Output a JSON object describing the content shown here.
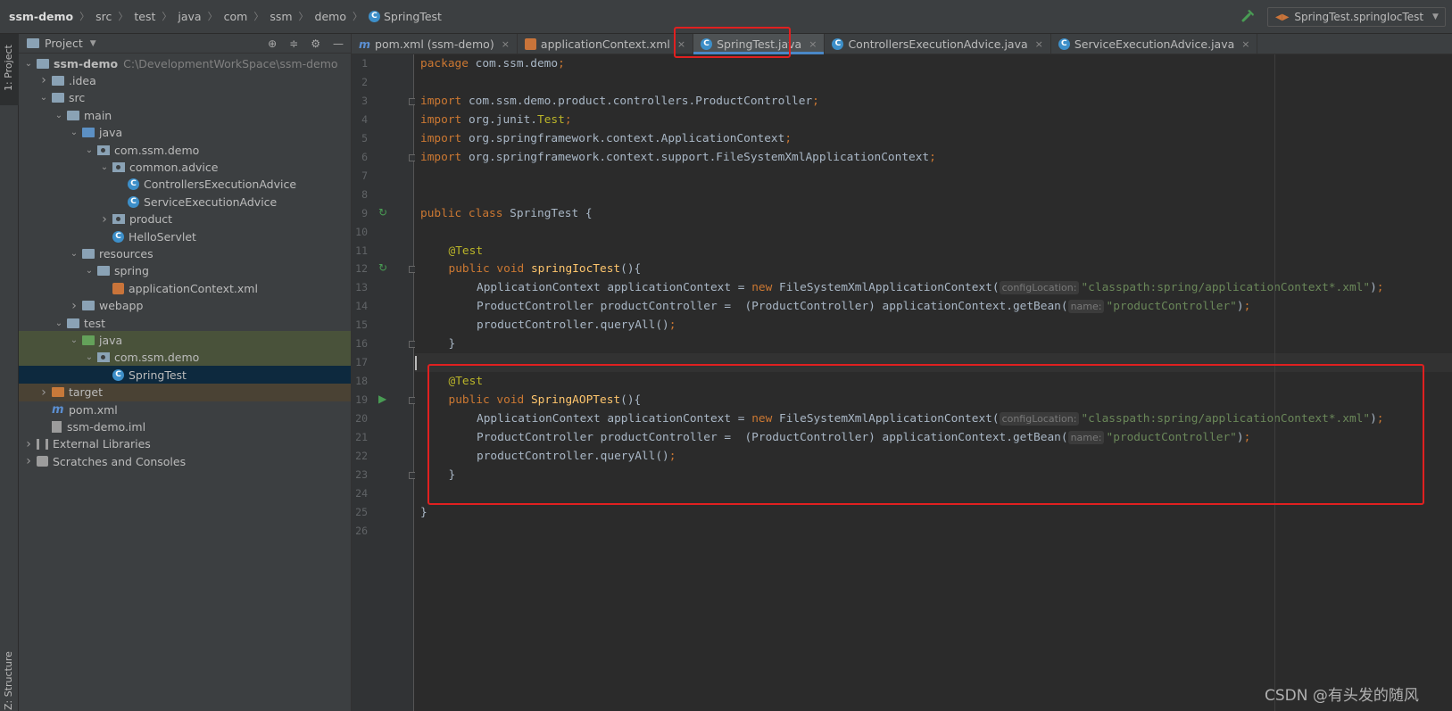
{
  "breadcrumb": {
    "items": [
      "ssm-demo",
      "src",
      "test",
      "java",
      "com",
      "ssm",
      "demo",
      "SpringTest"
    ]
  },
  "run_config": {
    "label": "SpringTest.springIocTest"
  },
  "left_stripe": {
    "project_label": "1: Project",
    "structure_label": "Z: Structure"
  },
  "project_panel": {
    "title": "Project",
    "tree": [
      {
        "label": "ssm-demo",
        "extra": "C:\\DevelopmentWorkSpace\\ssm-demo",
        "depth": 0,
        "arrow": "down",
        "icon": "module"
      },
      {
        "label": ".idea",
        "depth": 1,
        "arrow": "right",
        "icon": "folder"
      },
      {
        "label": "src",
        "depth": 1,
        "arrow": "down",
        "icon": "folder"
      },
      {
        "label": "main",
        "depth": 2,
        "arrow": "down",
        "icon": "folder"
      },
      {
        "label": "java",
        "depth": 3,
        "arrow": "down",
        "icon": "folder-src"
      },
      {
        "label": "com.ssm.demo",
        "depth": 4,
        "arrow": "down",
        "icon": "package"
      },
      {
        "label": "common.advice",
        "depth": 5,
        "arrow": "down",
        "icon": "package"
      },
      {
        "label": "ControllersExecutionAdvice",
        "depth": 6,
        "arrow": "none",
        "icon": "class"
      },
      {
        "label": "ServiceExecutionAdvice",
        "depth": 6,
        "arrow": "none",
        "icon": "class"
      },
      {
        "label": "product",
        "depth": 5,
        "arrow": "right",
        "icon": "package"
      },
      {
        "label": "HelloServlet",
        "depth": 5,
        "arrow": "none",
        "icon": "class"
      },
      {
        "label": "resources",
        "depth": 3,
        "arrow": "down",
        "icon": "folder-res"
      },
      {
        "label": "spring",
        "depth": 4,
        "arrow": "down",
        "icon": "folder"
      },
      {
        "label": "applicationContext.xml",
        "depth": 5,
        "arrow": "none",
        "icon": "xml"
      },
      {
        "label": "webapp",
        "depth": 3,
        "arrow": "right",
        "icon": "folder"
      },
      {
        "label": "test",
        "depth": 2,
        "arrow": "down",
        "icon": "folder"
      },
      {
        "label": "java",
        "depth": 3,
        "arrow": "down",
        "icon": "folder-test",
        "style": "hl-test"
      },
      {
        "label": "com.ssm.demo",
        "depth": 4,
        "arrow": "down",
        "icon": "package",
        "style": "hl-test"
      },
      {
        "label": "SpringTest",
        "depth": 5,
        "arrow": "none",
        "icon": "class",
        "style": "sel"
      },
      {
        "label": "target",
        "depth": 1,
        "arrow": "right",
        "icon": "folder-target",
        "style": "excl"
      },
      {
        "label": "pom.xml",
        "depth": 1,
        "arrow": "none",
        "icon": "maven"
      },
      {
        "label": "ssm-demo.iml",
        "depth": 1,
        "arrow": "none",
        "icon": "file"
      },
      {
        "label": "External Libraries",
        "depth": 0,
        "arrow": "right",
        "icon": "libs"
      },
      {
        "label": "Scratches and Consoles",
        "depth": 0,
        "arrow": "right",
        "icon": "scratch"
      }
    ]
  },
  "tabs": [
    {
      "label": "pom.xml (ssm-demo)",
      "icon": "maven",
      "close": "×"
    },
    {
      "label": "applicationContext.xml",
      "icon": "xml",
      "close": "×"
    },
    {
      "label": "SpringTest.java",
      "icon": "class",
      "close": "×",
      "active": true
    },
    {
      "label": "ControllersExecutionAdvice.java",
      "icon": "class",
      "close": "×"
    },
    {
      "label": "ServiceExecutionAdvice.java",
      "icon": "class",
      "close": "×"
    }
  ],
  "code_lines": [
    {
      "n": "1",
      "indent": 0,
      "parts": [
        {
          "c": "kw",
          "t": "package "
        },
        {
          "t": "com.ssm.demo"
        },
        {
          "c": "kw",
          "t": ";"
        }
      ]
    },
    {
      "n": "2",
      "indent": 0,
      "parts": []
    },
    {
      "n": "3",
      "indent": 0,
      "parts": [
        {
          "c": "kw",
          "t": "import "
        },
        {
          "t": "com.ssm.demo.product.controllers.ProductController"
        },
        {
          "c": "kw",
          "t": ";"
        }
      ]
    },
    {
      "n": "4",
      "indent": 0,
      "parts": [
        {
          "c": "kw",
          "t": "import "
        },
        {
          "t": "org.junit."
        },
        {
          "c": "an",
          "t": "Test"
        },
        {
          "c": "kw",
          "t": ";"
        }
      ]
    },
    {
      "n": "5",
      "indent": 0,
      "parts": [
        {
          "c": "kw",
          "t": "import "
        },
        {
          "t": "org.springframework.context.ApplicationContext"
        },
        {
          "c": "kw",
          "t": ";"
        }
      ]
    },
    {
      "n": "6",
      "indent": 0,
      "parts": [
        {
          "c": "kw",
          "t": "import "
        },
        {
          "t": "org.springframework.context.support.FileSystemXmlApplicationContext"
        },
        {
          "c": "kw",
          "t": ";"
        }
      ]
    },
    {
      "n": "7",
      "indent": 0,
      "parts": []
    },
    {
      "n": "8",
      "indent": 0,
      "parts": []
    },
    {
      "n": "9",
      "indent": 0,
      "parts": [
        {
          "c": "kw",
          "t": "public class "
        },
        {
          "t": "SpringTest {"
        }
      ]
    },
    {
      "n": "10",
      "indent": 0,
      "parts": []
    },
    {
      "n": "11",
      "indent": 1,
      "parts": [
        {
          "c": "an",
          "t": "@Test"
        }
      ]
    },
    {
      "n": "12",
      "indent": 1,
      "parts": [
        {
          "c": "kw",
          "t": "public void "
        },
        {
          "c": "fn",
          "t": "springIocTest"
        },
        {
          "t": "(){"
        }
      ]
    },
    {
      "n": "13",
      "indent": 2,
      "parts": [
        {
          "t": "ApplicationContext applicationContext = "
        },
        {
          "c": "kw",
          "t": "new "
        },
        {
          "t": "FileSystemXmlApplicationContext("
        },
        {
          "c": "hint",
          "t": "configLocation:"
        },
        {
          "c": "str",
          "t": "\"classpath:spring/applicationContext*.xml\""
        },
        {
          "t": ")"
        },
        {
          "c": "kw",
          "t": ";"
        }
      ]
    },
    {
      "n": "14",
      "indent": 2,
      "parts": [
        {
          "t": "ProductController productController =  (ProductController) applicationContext.getBean("
        },
        {
          "c": "hint",
          "t": "name:"
        },
        {
          "c": "str",
          "t": "\"productController\""
        },
        {
          "t": ")"
        },
        {
          "c": "kw",
          "t": ";"
        }
      ]
    },
    {
      "n": "15",
      "indent": 2,
      "parts": [
        {
          "t": "productController.queryAll()"
        },
        {
          "c": "kw",
          "t": ";"
        }
      ]
    },
    {
      "n": "16",
      "indent": 1,
      "parts": [
        {
          "t": "}"
        }
      ]
    },
    {
      "n": "17",
      "indent": 0,
      "parts": [],
      "current": true
    },
    {
      "n": "18",
      "indent": 1,
      "parts": [
        {
          "c": "an",
          "t": "@Test"
        }
      ]
    },
    {
      "n": "19",
      "indent": 1,
      "parts": [
        {
          "c": "kw",
          "t": "public void "
        },
        {
          "c": "fn",
          "t": "SpringAOPTest"
        },
        {
          "t": "(){"
        }
      ]
    },
    {
      "n": "20",
      "indent": 2,
      "parts": [
        {
          "t": "ApplicationContext applicationContext = "
        },
        {
          "c": "kw",
          "t": "new "
        },
        {
          "t": "FileSystemXmlApplicationContext("
        },
        {
          "c": "hint",
          "t": "configLocation:"
        },
        {
          "c": "str",
          "t": "\"classpath:spring/applicationContext*.xml\""
        },
        {
          "t": ")"
        },
        {
          "c": "kw",
          "t": ";"
        }
      ]
    },
    {
      "n": "21",
      "indent": 2,
      "parts": [
        {
          "t": "ProductController productController =  (ProductController) applicationContext.getBean("
        },
        {
          "c": "hint",
          "t": "name:"
        },
        {
          "c": "str",
          "t": "\"productController\""
        },
        {
          "t": ")"
        },
        {
          "c": "kw",
          "t": ";"
        }
      ]
    },
    {
      "n": "22",
      "indent": 2,
      "parts": [
        {
          "t": "productController.queryAll()"
        },
        {
          "c": "kw",
          "t": ";"
        }
      ]
    },
    {
      "n": "23",
      "indent": 1,
      "parts": [
        {
          "t": "}"
        }
      ]
    },
    {
      "n": "24",
      "indent": 0,
      "parts": []
    },
    {
      "n": "25",
      "indent": 0,
      "parts": [
        {
          "t": "}"
        }
      ]
    },
    {
      "n": "26",
      "indent": 0,
      "parts": []
    }
  ],
  "gutter_icons": [
    {
      "line": "9",
      "icon": "run-class-icon",
      "glyph": "↻"
    },
    {
      "line": "12",
      "icon": "run-test-passed-icon",
      "glyph": "↻"
    },
    {
      "line": "19",
      "icon": "run-test-icon",
      "glyph": "▶"
    }
  ],
  "watermark": "CSDN @有头发的随风",
  "colors": {
    "keyword": "#cc7832",
    "annotation": "#bbb529",
    "method": "#ffc66d",
    "string": "#6a8759",
    "highlight_box": "#e02020",
    "active_tab_underline": "#4a88c7"
  }
}
